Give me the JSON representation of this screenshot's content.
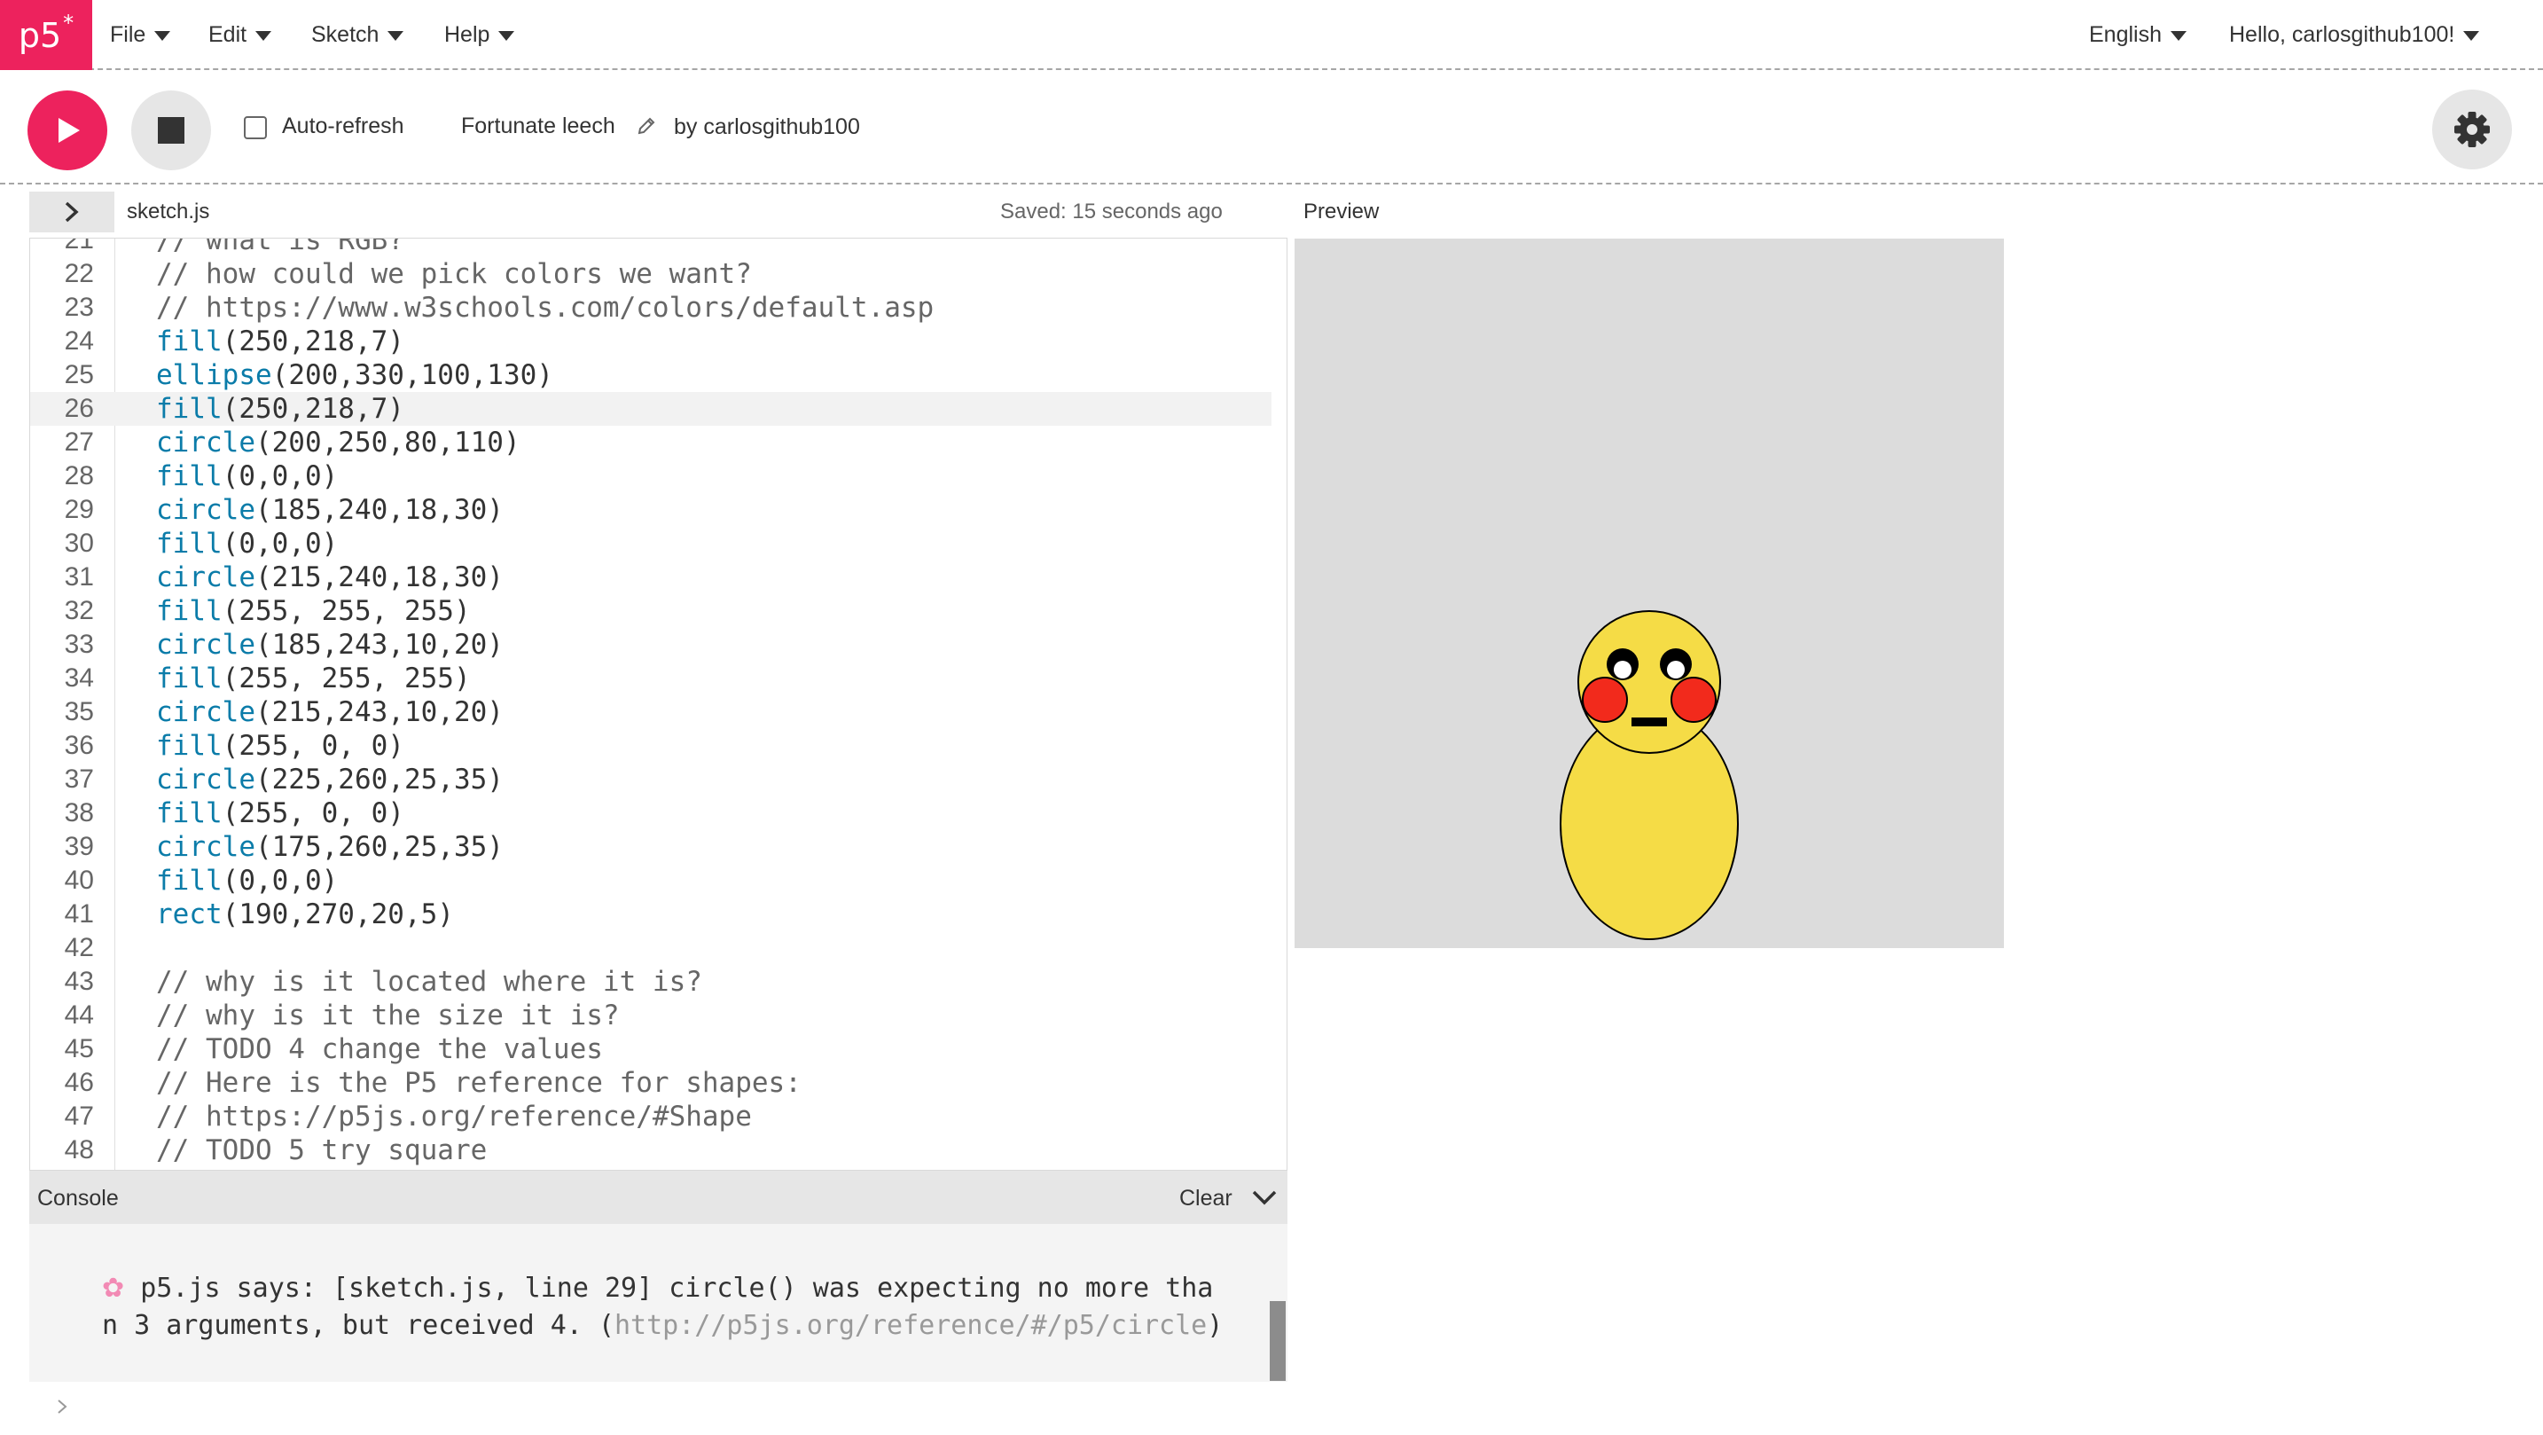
{
  "nav": {
    "logo": "p5",
    "logo_asterisk": "*",
    "menus": [
      "File",
      "Edit",
      "Sketch",
      "Help"
    ],
    "language": "English",
    "user_greeting": "Hello, carlosgithub100!"
  },
  "toolbar": {
    "auto_refresh_label": "Auto-refresh",
    "auto_refresh_checked": false,
    "sketch_name": "Fortunate leech",
    "by_author": "by carlosgithub100"
  },
  "editor": {
    "file_name": "sketch.js",
    "saved_status": "Saved: 15 seconds ago",
    "active_line": 26,
    "lines": [
      {
        "n": "21",
        "text": "// what is RGB?"
      },
      {
        "n": "22",
        "text": "// how could we pick colors we want?"
      },
      {
        "n": "23",
        "text": "// https://www.w3schools.com/colors/default.asp"
      },
      {
        "n": "24",
        "fn": "fill",
        "args": "(250,218,7)"
      },
      {
        "n": "25",
        "fn": "ellipse",
        "args": "(200,330,100,130)"
      },
      {
        "n": "26",
        "fn": "fill",
        "args": "(250,218,7)"
      },
      {
        "n": "27",
        "fn": "circle",
        "args": "(200,250,80,110)"
      },
      {
        "n": "28",
        "fn": "fill",
        "args": "(0,0,0)"
      },
      {
        "n": "29",
        "fn": "circle",
        "args": "(185,240,18,30)"
      },
      {
        "n": "30",
        "fn": "fill",
        "args": "(0,0,0)"
      },
      {
        "n": "31",
        "fn": "circle",
        "args": "(215,240,18,30)"
      },
      {
        "n": "32",
        "fn": "fill",
        "args": "(255, 255, 255)"
      },
      {
        "n": "33",
        "fn": "circle",
        "args": "(185,243,10,20)"
      },
      {
        "n": "34",
        "fn": "fill",
        "args": "(255, 255, 255)"
      },
      {
        "n": "35",
        "fn": "circle",
        "args": "(215,243,10,20)"
      },
      {
        "n": "36",
        "fn": "fill",
        "args": "(255, 0, 0)"
      },
      {
        "n": "37",
        "fn": "circle",
        "args": "(225,260,25,35)"
      },
      {
        "n": "38",
        "fn": "fill",
        "args": "(255, 0, 0)"
      },
      {
        "n": "39",
        "fn": "circle",
        "args": "(175,260,25,35)"
      },
      {
        "n": "40",
        "fn": "fill",
        "args": "(0,0,0)"
      },
      {
        "n": "41",
        "fn": "rect",
        "args": "(190,270,20,5)"
      },
      {
        "n": "42",
        "text": ""
      },
      {
        "n": "43",
        "text": "// why is it located where it is?"
      },
      {
        "n": "44",
        "text": "// why is it the size it is?"
      },
      {
        "n": "45",
        "text": "// TODO 4 change the values"
      },
      {
        "n": "46",
        "text": "// Here is the P5 reference for shapes:"
      },
      {
        "n": "47",
        "text": "// https://p5js.org/reference/#Shape"
      },
      {
        "n": "48",
        "text": "// TODO 5 try square"
      }
    ]
  },
  "preview": {
    "title": "Preview",
    "canvas_background": "#dcdcdc"
  },
  "console": {
    "title": "Console",
    "clear_label": "Clear",
    "message_prefix": "p5.js says: [sketch.js, line 29] circle() was expecting no more tha",
    "message_line2": "n 3 arguments, but received 4. (",
    "message_link": "http://p5js.org/reference/#/p5/circle",
    "message_suffix": ")"
  },
  "colors": {
    "accent": "#ed225d",
    "code_function": "#0b7ca9",
    "pikachu_yellow": "#f5dc46",
    "cheek_red": "#f22a1c"
  },
  "icons": {
    "play": "play-icon",
    "stop": "stop-icon",
    "pencil": "pencil-icon",
    "settings": "gear-icon",
    "sidebar": "chevron-right-icon",
    "console_collapse": "chevron-down-icon",
    "console_prompt": "chevron-right-icon",
    "console_flower": "flower-icon"
  }
}
